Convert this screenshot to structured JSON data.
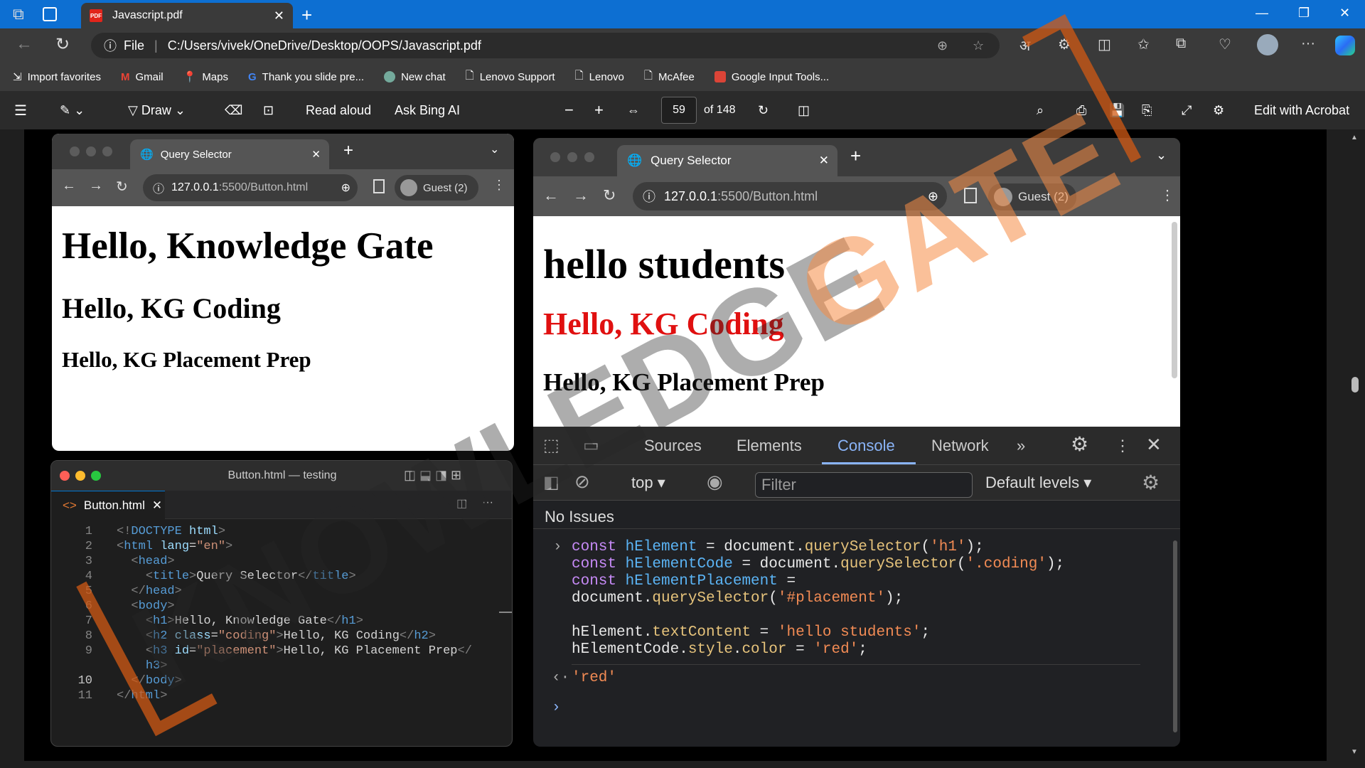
{
  "edge": {
    "tab_title": "Javascript.pdf",
    "url_label": "File",
    "url": "C:/Users/vivek/OneDrive/Desktop/OOPS/Javascript.pdf",
    "lang_icon": "अ"
  },
  "bookmarks": [
    "Import favorites",
    "Gmail",
    "Maps",
    "Thank you slide pre...",
    "New chat",
    "Lenovo Support",
    "Lenovo",
    "McAfee",
    "Google Input Tools..."
  ],
  "pdf_toolbar": {
    "draw": "Draw",
    "read_aloud": "Read aloud",
    "ask_bing": "Ask Bing AI",
    "page": "59",
    "of_pages": "of 148",
    "edit": "Edit with Acrobat"
  },
  "left_browser": {
    "tab": "Query Selector",
    "url_host": "127.0.0.1",
    "url_rest": ":5500/Button.html",
    "guest": "Guest (2)",
    "h1": "Hello, Knowledge Gate",
    "h2": "Hello, KG Coding",
    "h3": "Hello, KG Placement Prep"
  },
  "right_browser": {
    "tab": "Query Selector",
    "url_host": "127.0.0.1",
    "url_rest": ":5500/Button.html",
    "guest": "Guest (2)",
    "h1": "hello students",
    "h2": "Hello, KG Coding",
    "h3": "Hello, KG Placement Prep",
    "h2_color": "#e01010"
  },
  "devtools": {
    "tabs": [
      "Sources",
      "Elements",
      "Console",
      "Network"
    ],
    "active_tab": "Console",
    "context": "top",
    "filter_placeholder": "Filter",
    "levels": "Default levels",
    "no_issues": "No Issues",
    "result": "'red'"
  },
  "editor": {
    "title": "Button.html — testing",
    "file_tab": "Button.html",
    "line_numbers": [
      "1",
      "2",
      "3",
      "4",
      "5",
      "6",
      "7",
      "8",
      "9",
      "",
      "10",
      "11"
    ]
  },
  "watermark": "KNOWLEDGEGATE"
}
